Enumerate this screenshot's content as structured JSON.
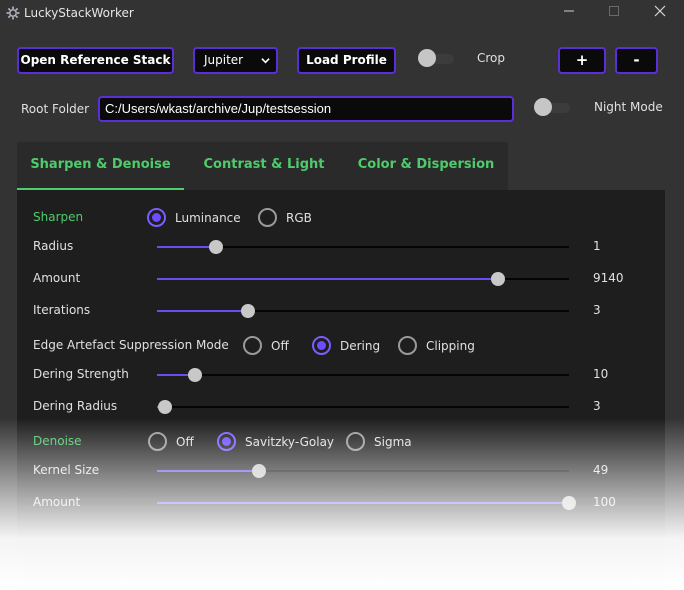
{
  "window": {
    "title": "LuckyStackWorker",
    "icon": "gear-icon"
  },
  "toolbar": {
    "open_reference": "Open Reference Stack",
    "planet_selected": "Jupiter",
    "load_profile": "Load Profile",
    "crop_label": "Crop",
    "crop_on": false,
    "plus": "+",
    "minus": "-"
  },
  "root": {
    "label": "Root Folder",
    "path": "C:/Users/wkast/archive/Jup/testsession",
    "night_mode_label": "Night Mode",
    "night_mode_on": false
  },
  "tabs": [
    {
      "label": "Sharpen & Denoise",
      "active": true
    },
    {
      "label": "Contrast & Light",
      "active": false
    },
    {
      "label": "Color & Dispersion",
      "active": false
    }
  ],
  "sharpen": {
    "title": "Sharpen",
    "mode_options": [
      "Luminance",
      "RGB"
    ],
    "mode_selected": "Luminance",
    "radius": {
      "label": "Radius",
      "value": "1",
      "fraction": 0.143
    },
    "amount": {
      "label": "Amount",
      "value": "9140",
      "fraction": 0.828
    },
    "iterations": {
      "label": "Iterations",
      "value": "3",
      "fraction": 0.222
    },
    "edge": {
      "label": "Edge Artefact Suppression Mode",
      "options": [
        "Off",
        "Dering",
        "Clipping"
      ],
      "selected": "Dering"
    },
    "dering_strength": {
      "label": "Dering Strength",
      "value": "10",
      "fraction": 0.092
    },
    "dering_radius": {
      "label": "Dering Radius",
      "value": "3",
      "fraction": 0.02
    }
  },
  "denoise": {
    "title": "Denoise",
    "options": [
      "Off",
      "Savitzky-Golay",
      "Sigma"
    ],
    "selected": "Savitzky-Golay",
    "kernel_size": {
      "label": "Kernel Size",
      "value": "49",
      "fraction": 0.248
    },
    "amount": {
      "label": "Amount",
      "value": "100",
      "fraction": 1.0
    }
  },
  "colors": {
    "accent": "#5b2fd6",
    "tab_text": "#4ecb6b",
    "slider_fill": "#6a4ff0"
  }
}
